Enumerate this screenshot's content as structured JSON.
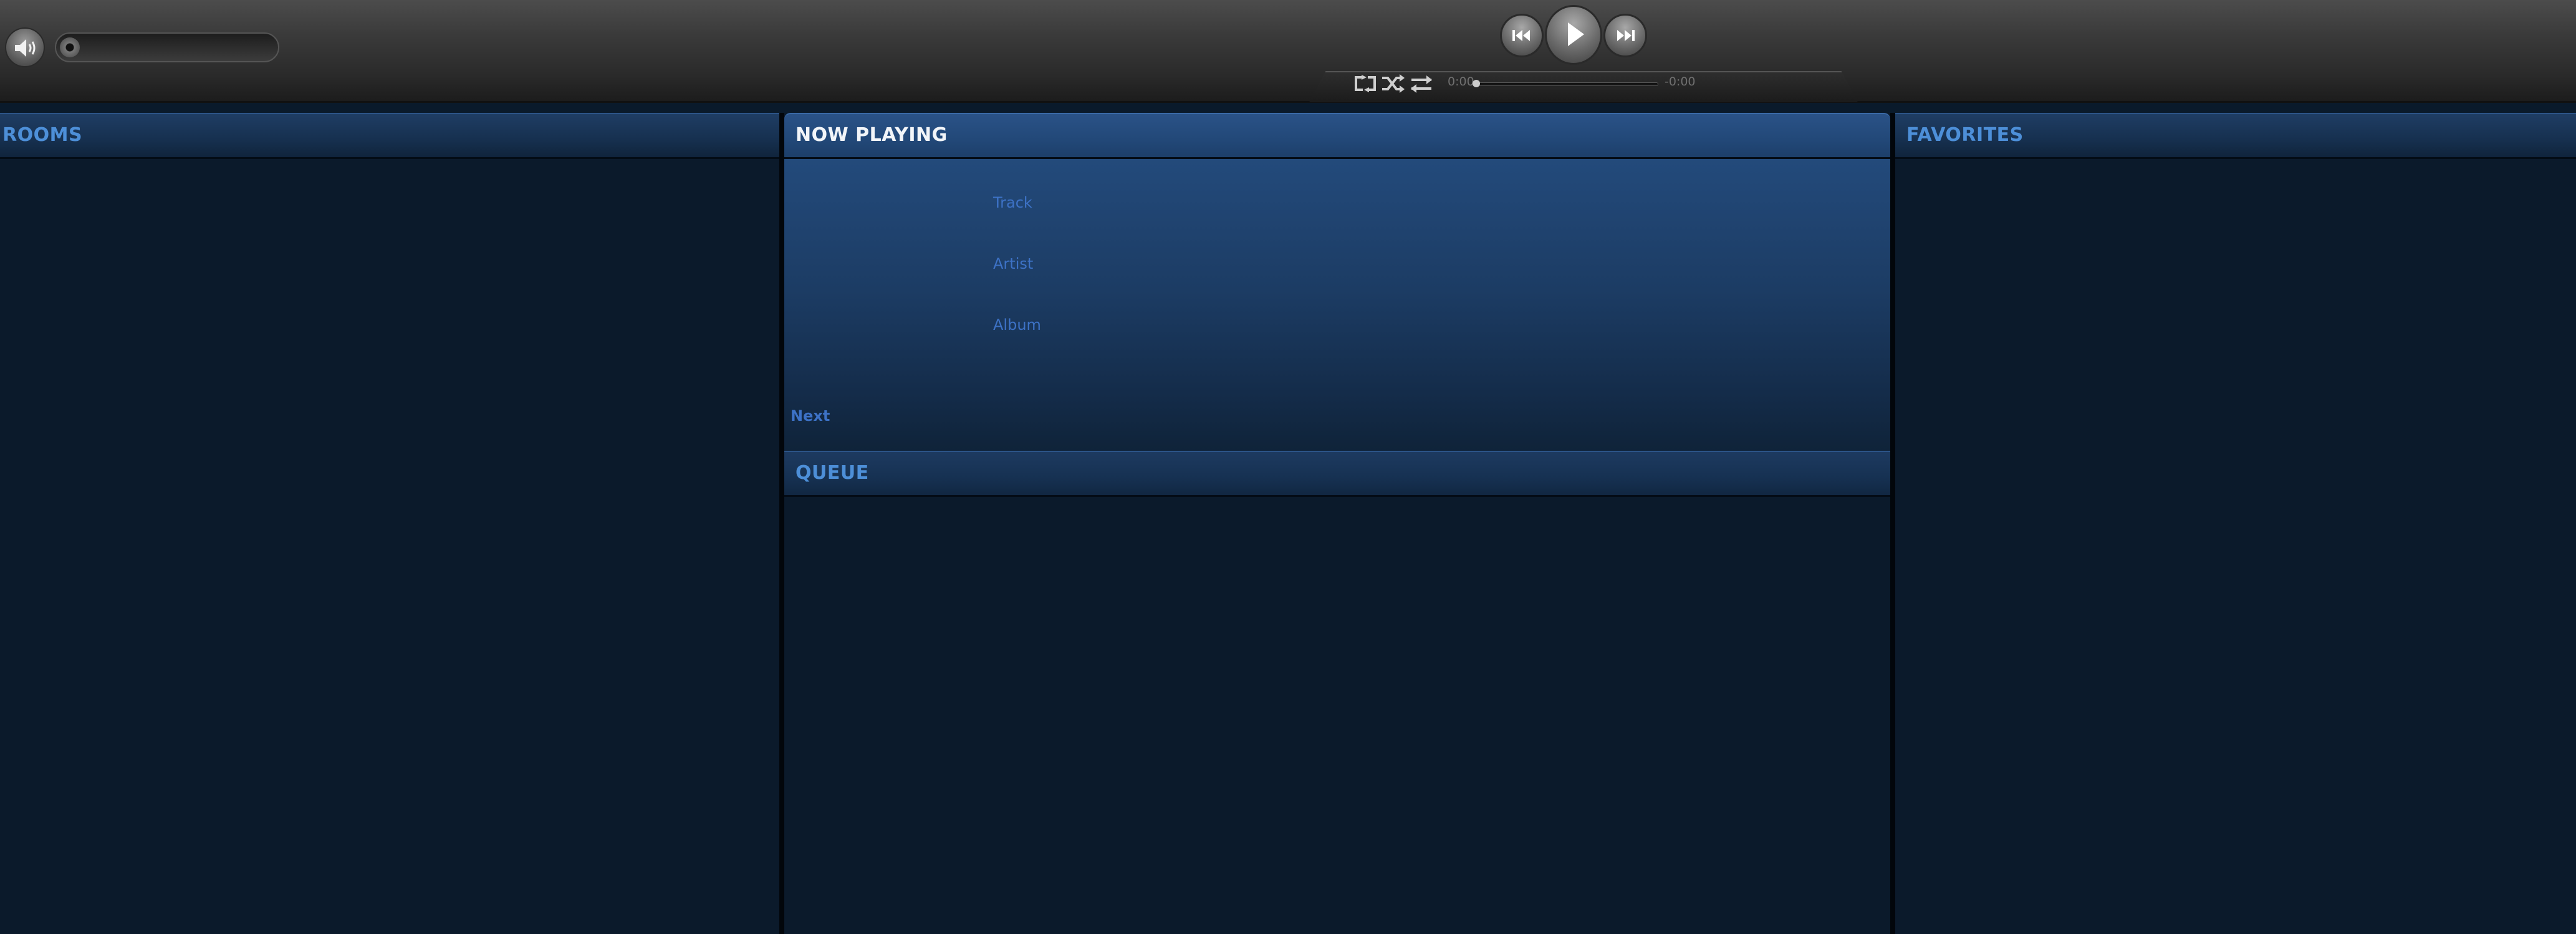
{
  "topbar": {
    "volume_icon": "volume-icon",
    "volume_level": 0.0,
    "transport": {
      "previous_icon": "skip-previous-icon",
      "play_icon": "play-icon",
      "next_icon": "skip-next-icon"
    },
    "modes": {
      "repeat_icon": "repeat-icon",
      "shuffle_icon": "shuffle-icon",
      "crossfade_icon": "crossfade-icon"
    },
    "time_elapsed": "0:00",
    "time_remaining": "-0:00",
    "progress": 0.0
  },
  "panels": {
    "rooms": {
      "title": "ROOMS"
    },
    "now_playing": {
      "title": "NOW PLAYING",
      "track": "Track",
      "artist": "Artist",
      "album": "Album",
      "next": "Next"
    },
    "queue": {
      "title": "QUEUE"
    },
    "favorites": {
      "title": "FAVORITES"
    }
  },
  "colors": {
    "panel_bg": "#0b1a2b",
    "header_text": "#4d8fd8",
    "now_playing_header_text": "#f2f5f9",
    "link_text": "#3d72c6"
  }
}
